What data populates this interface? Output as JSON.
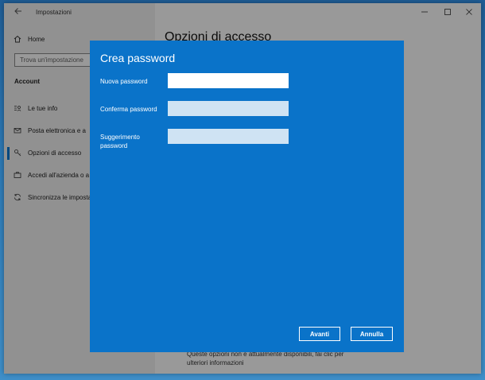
{
  "window": {
    "title": "Impostazioni"
  },
  "sidebar": {
    "home_label": "Home",
    "search_placeholder": "Trova un'impostazione",
    "section_label": "Account",
    "items": [
      {
        "label": "Le tue info"
      },
      {
        "label": "Posta elettronica e a"
      },
      {
        "label": "Opzioni di accesso"
      },
      {
        "label": "Accedi all'azienda o a"
      },
      {
        "label": "Sincronizza le imposta"
      }
    ]
  },
  "content": {
    "heading": "Opzioni di accesso",
    "footer_line1": "Queste opzioni non è attualmente disponibili, fai clic per",
    "footer_line2": "ulteriori informazioni"
  },
  "dialog": {
    "title": "Crea password",
    "fields": [
      {
        "label": "Nuova password",
        "value": ""
      },
      {
        "label": "Conferma password",
        "value": ""
      },
      {
        "label": "Suggerimento password",
        "value": ""
      }
    ],
    "ok_label": "Avanti",
    "cancel_label": "Annulla"
  },
  "colors": {
    "dialog_bg": "#0a73c9",
    "accent": "#0078d4"
  }
}
